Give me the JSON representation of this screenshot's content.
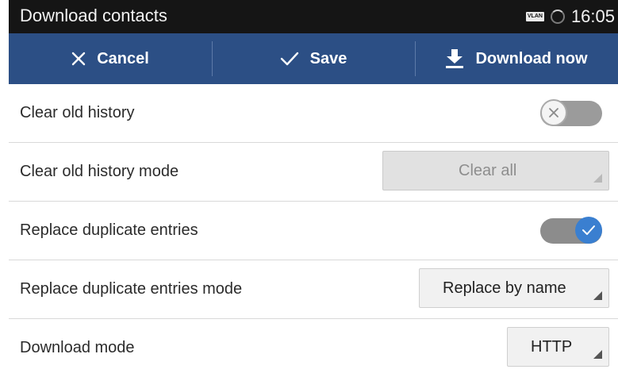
{
  "status_bar": {
    "title": "Download contacts",
    "vlan_badge": "VLAN",
    "time": "16:05"
  },
  "action_bar": {
    "cancel_label": "Cancel",
    "save_label": "Save",
    "download_label": "Download now",
    "background": "#2c4f85"
  },
  "settings": [
    {
      "label": "Clear old history",
      "control": "toggle",
      "checked": false
    },
    {
      "label": "Clear old history mode",
      "control": "select",
      "value": "Clear all",
      "disabled": true
    },
    {
      "label": "Replace duplicate entries",
      "control": "toggle",
      "checked": true
    },
    {
      "label": "Replace duplicate entries mode",
      "control": "select",
      "value": "Replace by name",
      "disabled": false
    },
    {
      "label": "Download mode",
      "control": "select",
      "value": "HTTP",
      "disabled": false
    }
  ],
  "colors": {
    "accent": "#3a7fd0",
    "status_bar": "#151515"
  }
}
